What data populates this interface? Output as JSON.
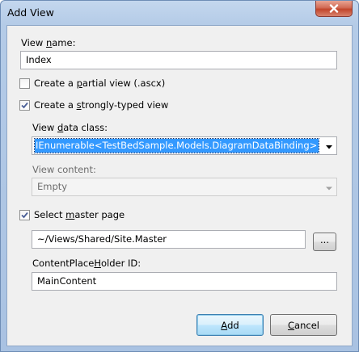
{
  "window": {
    "title": "Add View"
  },
  "view_name": {
    "label_pre": "View ",
    "label_accel": "n",
    "label_post": "ame:",
    "value": "Index"
  },
  "partial_view": {
    "checked": false,
    "label_pre": "Create a ",
    "label_accel": "p",
    "label_post": "artial view (.ascx)"
  },
  "strongly_typed": {
    "checked": true,
    "label_pre": "Create a ",
    "label_accel": "s",
    "label_post": "trongly-typed view"
  },
  "view_data_class": {
    "label_pre": "View ",
    "label_accel": "d",
    "label_post": "ata class:",
    "value": "IEnumerable<TestBedSample.Models.DiagramDataBinding>"
  },
  "view_content": {
    "label": "View content:",
    "value": "Empty"
  },
  "master_page": {
    "checked": true,
    "label_pre": "Select ",
    "label_accel": "m",
    "label_post": "aster page",
    "value": "~/Views/Shared/Site.Master",
    "browse_label": "..."
  },
  "content_placeholder": {
    "label_pre": "ContentPlace",
    "label_accel": "H",
    "label_post": "older ID:",
    "value": "MainContent"
  },
  "buttons": {
    "add_accel": "A",
    "add_rest": "dd",
    "cancel_accel": "C",
    "cancel_rest": "ancel"
  },
  "icons": {
    "close": "close-icon",
    "checkmark": "checkmark-icon",
    "dropdown": "chevron-down-icon"
  }
}
